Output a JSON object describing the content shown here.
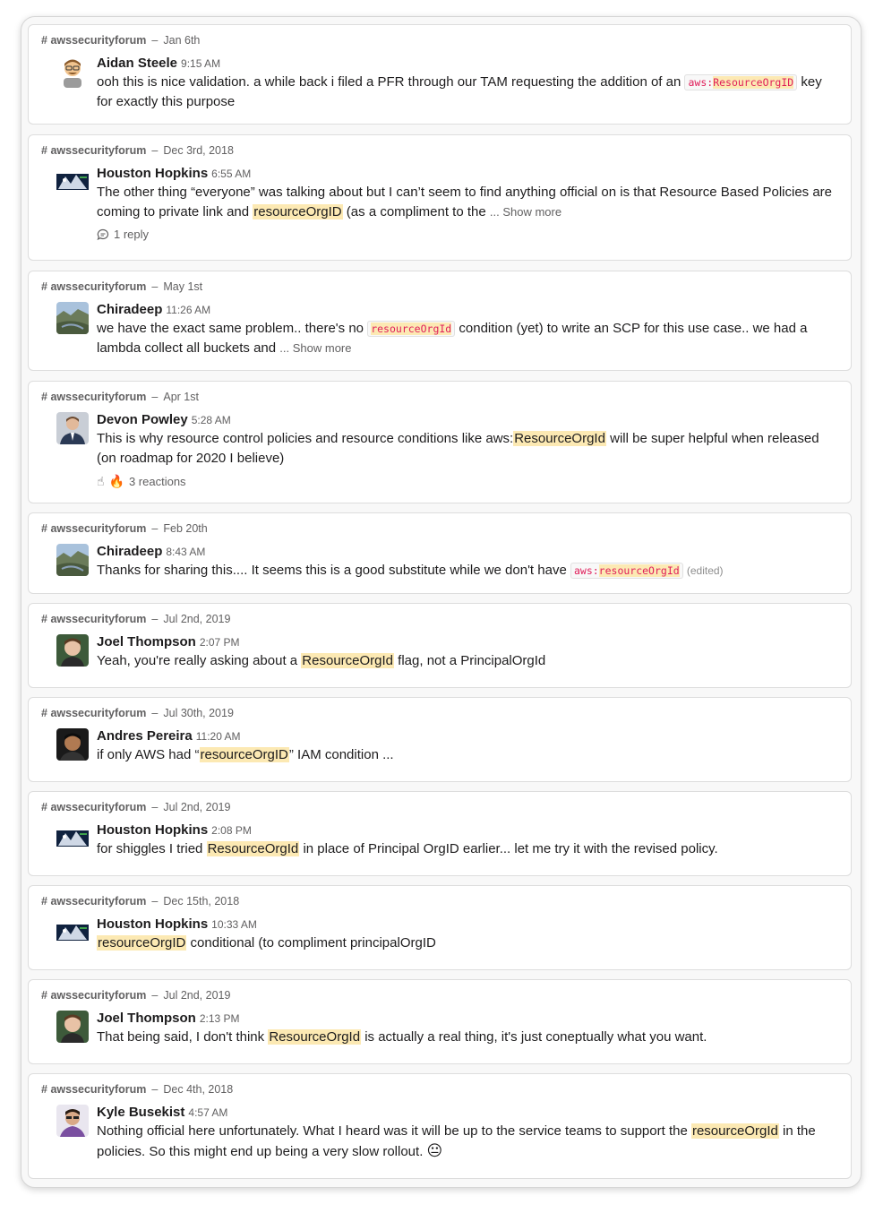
{
  "messages": [
    {
      "channel": "awssecurityforum",
      "date": "Jan 6th",
      "author": "Aidan Steele",
      "time": "9:15 AM",
      "t1": "ooh this is nice validation. a while back i filed a PFR through our TAM requesting the addition of an ",
      "code_prefix": "aws:",
      "code_hl": "ResourceOrgID",
      "t2": " key for exactly this purpose"
    },
    {
      "channel": "awssecurityforum",
      "date": "Dec 3rd, 2018",
      "author": "Houston Hopkins",
      "time": "6:55 AM",
      "t1": "The other thing “everyone” was talking about but I can’t seem to find anything official on is that Resource Based Policies are coming to private link and ",
      "hl": "resourceOrgID",
      "t2": " (as a compliment to the ",
      "more": "... Show more",
      "replies": "1 reply"
    },
    {
      "channel": "awssecurityforum",
      "date": "May 1st",
      "author": "Chiradeep",
      "time": "11:26 AM",
      "t1": "we have the exact same problem.. there's no ",
      "code_hl": "resourceOrgId",
      "t2": " condition (yet) to write an SCP for this use case.. we had a lambda collect all buckets and ",
      "more": "... Show more"
    },
    {
      "channel": "awssecurityforum",
      "date": "Apr 1st",
      "author": "Devon Powley",
      "time": "5:28 AM",
      "t1": "This is why resource control policies and resource conditions like aws:",
      "hl": "ResourceOrgId",
      "t2": " will be super helpful when released (on roadmap for 2020 I believe)",
      "reaction1": "☝",
      "reaction2": "🔥",
      "reactions": "3 reactions"
    },
    {
      "channel": "awssecurityforum",
      "date": "Feb 20th",
      "author": "Chiradeep",
      "time": "8:43 AM",
      "t1": "Thanks for sharing this.... It seems this is a good substitute while we don't have ",
      "code_prefix": "aws:",
      "code_hl": "resourceOrgId",
      "edited": "(edited)"
    },
    {
      "channel": "awssecurityforum",
      "date": "Jul 2nd, 2019",
      "author": "Joel Thompson",
      "time": "2:07 PM",
      "t1": "Yeah, you're really asking about a ",
      "hl": "ResourceOrgId",
      "t2": " flag, not a PrincipalOrgId"
    },
    {
      "channel": "awssecurityforum",
      "date": "Jul 30th, 2019",
      "author": "Andres Pereira",
      "time": "11:20 AM",
      "t1": "if only AWS had “",
      "hl": "resourceOrgID",
      "t2": "” IAM condition ..."
    },
    {
      "channel": "awssecurityforum",
      "date": "Jul 2nd, 2019",
      "author": "Houston Hopkins",
      "time": "2:08 PM",
      "t1": "for shiggles I tried ",
      "hl": "ResourceOrgId",
      "t2": " in place of Principal OrgID earlier... let me try it with the revised policy."
    },
    {
      "channel": "awssecurityforum",
      "date": "Dec 15th, 2018",
      "author": "Houston Hopkins",
      "time": "10:33 AM",
      "t1": "",
      "hl": "resourceOrgID",
      "t2": "  conditional (to compliment principalOrgID"
    },
    {
      "channel": "awssecurityforum",
      "date": "Jul 2nd, 2019",
      "author": "Joel Thompson",
      "time": "2:13 PM",
      "t1": "That being said, I don't think ",
      "hl": "ResourceOrgId",
      "t2": " is actually a real thing, it's just coneptually what you want."
    },
    {
      "channel": "awssecurityforum",
      "date": "Dec 4th, 2018",
      "author": "Kyle Busekist",
      "time": "4:57 AM",
      "t1": "Nothing official here unfortunately. What I heard was it will be up to the service teams to support the ",
      "hl": "resourceOrgId",
      "t2": " in the policies. So this might end up being a very slow rollout. ",
      "emoji": "😐"
    }
  ]
}
